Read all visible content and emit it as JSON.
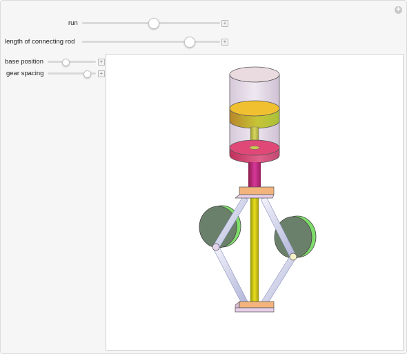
{
  "controls": [
    {
      "label": "run",
      "value": 0.52
    },
    {
      "label": "length of connecting rod",
      "value": 0.78
    },
    {
      "label": "base position",
      "value": 0.38
    },
    {
      "label": "gear spacing",
      "value": 0.82
    }
  ],
  "colors": {
    "cylinder_fill": "#e0d4e4",
    "piston": "#e8b630",
    "lower_piston": "#d8406e",
    "rod_magenta": "#c22d7a",
    "center_rod": "#d8cf10",
    "block": "#f2b47c",
    "wheel": "#6b806a",
    "wheel_rim": "#7fdc6c",
    "link": "#e6e6f0"
  },
  "icons": [
    "add-circle-icon",
    "plus-square-icon"
  ]
}
